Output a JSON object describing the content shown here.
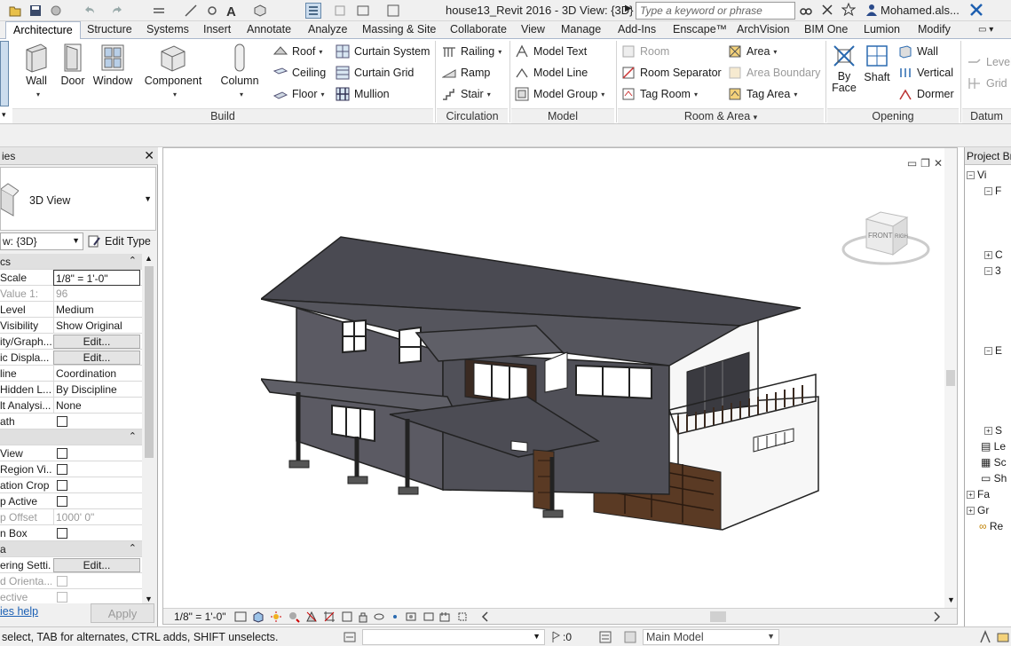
{
  "titlebar": {
    "document_title": "house13_Revit 2016 - 3D View: {3D}",
    "search_placeholder": "Type a keyword or phrase",
    "user": "Mohamed.als..."
  },
  "ribbon_tabs": [
    "Architecture",
    "Structure",
    "Systems",
    "Insert",
    "Annotate",
    "Analyze",
    "Massing & Site",
    "Collaborate",
    "View",
    "Manage",
    "Add-Ins",
    "Enscape™",
    "ArchVision",
    "BIM One",
    "Lumion",
    "Modify"
  ],
  "ribbon": {
    "build": {
      "title": "Build",
      "wall": "Wall",
      "door": "Door",
      "window": "Window",
      "component": "Component",
      "column": "Column",
      "roof": "Roof",
      "ceiling": "Ceiling",
      "floor": "Floor",
      "curtain_system": "Curtain System",
      "curtain_grid": "Curtain Grid",
      "mullion": "Mullion"
    },
    "circulation": {
      "title": "Circulation",
      "railing": "Railing",
      "ramp": "Ramp",
      "stair": "Stair"
    },
    "model": {
      "title": "Model",
      "model_text": "Model  Text",
      "model_line": "Model  Line",
      "model_group": "Model  Group"
    },
    "room_area": {
      "title": "Room & Area",
      "room": "Room",
      "room_separator": "Room  Separator",
      "tag_room": "Tag  Room",
      "area": "Area",
      "area_boundary": "Area  Boundary",
      "tag_area": "Tag  Area"
    },
    "opening": {
      "title": "Opening",
      "by_face_1": "By",
      "by_face_2": "Face",
      "shaft": "Shaft",
      "wall": "Wall",
      "vertical": "Vertical",
      "dormer": "Dormer"
    },
    "datum": {
      "title": "Datum",
      "level": "Level",
      "grid": "Grid"
    }
  },
  "properties": {
    "header": "ies",
    "type_name": "3D View",
    "instance_filter": "w: {3D}",
    "edit_type": "Edit Type",
    "rows": [
      {
        "name": "cs",
        "value": "",
        "kind": "group"
      },
      {
        "name": "Scale",
        "value": "1/8\" = 1'-0\"",
        "kind": "text"
      },
      {
        "name": "Value   1:",
        "value": "96",
        "kind": "grey"
      },
      {
        "name": "Level",
        "value": "Medium",
        "kind": "text"
      },
      {
        "name": "Visibility",
        "value": "Show Original",
        "kind": "text"
      },
      {
        "name": "ity/Graph...",
        "value": "Edit...",
        "kind": "button"
      },
      {
        "name": "ic Displa...",
        "value": "Edit...",
        "kind": "button"
      },
      {
        "name": "line",
        "value": "Coordination",
        "kind": "text"
      },
      {
        "name": "Hidden L...",
        "value": "By Discipline",
        "kind": "text"
      },
      {
        "name": "lt Analysi...",
        "value": "None",
        "kind": "text"
      },
      {
        "name": "ath",
        "value": "",
        "kind": "check"
      },
      {
        "name": "",
        "value": "",
        "kind": "group"
      },
      {
        "name": "View",
        "value": "",
        "kind": "check"
      },
      {
        "name": "Region Vi...",
        "value": "",
        "kind": "check"
      },
      {
        "name": "ation Crop",
        "value": "",
        "kind": "check"
      },
      {
        "name": "p Active",
        "value": "",
        "kind": "check"
      },
      {
        "name": "p Offset",
        "value": "1000'  0\"",
        "kind": "grey"
      },
      {
        "name": "n Box",
        "value": "",
        "kind": "check"
      },
      {
        "name": "a",
        "value": "",
        "kind": "group"
      },
      {
        "name": "ering Setti...",
        "value": "Edit...",
        "kind": "button"
      },
      {
        "name": "d Orienta...",
        "value": "",
        "kind": "greycheck"
      },
      {
        "name": "ective",
        "value": "",
        "kind": "greycheck"
      }
    ],
    "help": "ies help",
    "apply": "Apply"
  },
  "view": {
    "scale": "1/8\" = 1'-0\"",
    "viewcube": {
      "front": "FRONT",
      "right": "RIGH"
    }
  },
  "browser": {
    "header": "Project Br",
    "items": [
      {
        "indent": 0,
        "label": "Vi"
      },
      {
        "indent": 2,
        "label": "F"
      },
      {
        "indent": 2,
        "label": "C"
      },
      {
        "indent": 2,
        "label": "3"
      },
      {
        "indent": 2,
        "label": "E"
      },
      {
        "indent": 2,
        "label": "S"
      },
      {
        "indent": 1,
        "label": "Le"
      },
      {
        "indent": 1,
        "label": "Sc"
      },
      {
        "indent": 1,
        "label": "Sh"
      },
      {
        "indent": 0,
        "label": "Fa"
      },
      {
        "indent": 0,
        "label": "Gr"
      },
      {
        "indent": 0,
        "label": "Re"
      }
    ]
  },
  "status": {
    "text": "select, TAB for alternates, CTRL adds, SHIFT unselects.",
    "zero": ":0",
    "main_model": "Main Model"
  }
}
